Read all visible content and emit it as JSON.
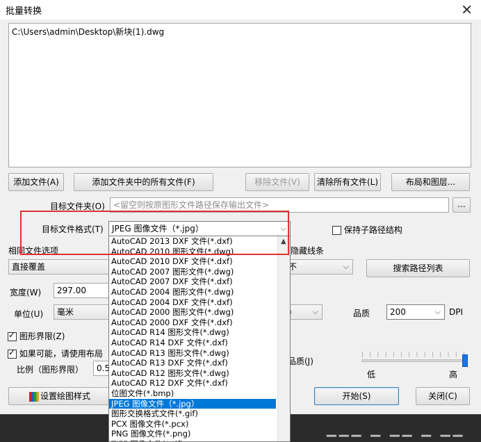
{
  "window": {
    "title": "批量转换",
    "close_glyph": "✕"
  },
  "file_list": {
    "items": [
      "C:\\Users\\admin\\Desktop\\新块(1).dwg"
    ]
  },
  "buttons": {
    "add_file": "添加文件(A)",
    "add_folder_files": "添加文件夹中的所有文件(F)",
    "remove_file": "移除文件(V)",
    "clear_all": "清除所有文件(L)",
    "layout_layers": "布局和图层...",
    "browse": "...",
    "search_paths": "搜索路径列表",
    "plot_style": "设置绘图样式",
    "start": "开始(S)",
    "close": "关闭(C)"
  },
  "target_folder": {
    "label": "目标文件夹(O)",
    "placeholder": "<留空则按原图形文件路径保存输出文件>"
  },
  "target_format": {
    "label": "目标文件格式(T)",
    "value": "JPEG 图像文件（*.jpg）"
  },
  "keep_subpath": {
    "label": "保持子路径结构",
    "checked": false
  },
  "same_name": {
    "label": "相同文件选项",
    "value": "直接覆盖"
  },
  "hidden_lines": {
    "label_fragment": "隐藏线条",
    "value_fragment": "不"
  },
  "width": {
    "label": "宽度(W)",
    "value": "297.00"
  },
  "unit": {
    "label": "单位(U)",
    "value": "毫米"
  },
  "dpi_select": {
    "value_fragment": ")"
  },
  "quality": {
    "label": "品质",
    "value": "200",
    "suffix": "DPI"
  },
  "extents": {
    "label": "图形界限(Z)",
    "checked": true
  },
  "use_layout": {
    "label": "如果可能，请使用布局",
    "checked": true
  },
  "scale": {
    "label": "比例（图形界限）",
    "value_fragment": "0.5"
  },
  "image_quality": {
    "label_fragment": "品质(J)",
    "low": "低",
    "high": "高",
    "level": 1.0
  },
  "format_options": [
    "AutoCAD 2013 DXF 文件(*.dxf)",
    "AutoCAD 2010 图形文件(*.dwg)",
    "AutoCAD 2010 DXF 文件(*.dxf)",
    "AutoCAD 2007 图形文件(*.dwg)",
    "AutoCAD 2007 DXF 文件(*.dxf)",
    "AutoCAD 2004 图形文件(*.dwg)",
    "AutoCAD 2004 DXF 文件(*.dxf)",
    "AutoCAD 2000 图形文件(*.dwg)",
    "AutoCAD 2000 DXF 文件(*.dxf)",
    "AutoCAD R14 图形文件(*.dwg)",
    "AutoCAD R14 DXF 文件(*.dxf)",
    "AutoCAD R13 图形文件(*.dwg)",
    "AutoCAD R13 DXF 文件(*.dxf)",
    "AutoCAD R12 图形文件(*.dwg)",
    "AutoCAD R12 DXF 文件(*.dxf)",
    "位图文件(*.bmp)",
    "JPEG 图像文件（*.jpg）",
    "图形交换格式文件(*.gif)",
    "PCX 图像文件(*.pcx)",
    "PNG 图像文件(*.png)",
    "TIFF 图像文件(*.tif)"
  ],
  "selected_format_index": 16,
  "colors": {
    "selection": "#0078d7",
    "highlight_box": "#e03030",
    "slider": "#1a73e8"
  }
}
